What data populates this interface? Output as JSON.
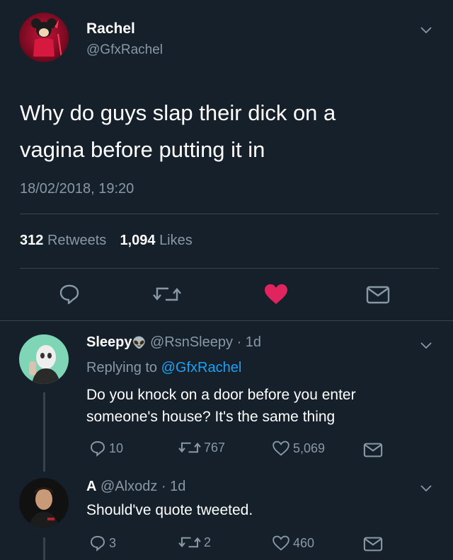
{
  "main_tweet": {
    "author_name": "Rachel",
    "author_handle": "@GfxRachel",
    "text_line1": "Why do guys slap their dick on a",
    "text_line2": "vagina before putting it in",
    "timestamp": "18/02/2018, 19:20",
    "retweets_count": "312",
    "retweets_label": "Retweets",
    "likes_count": "1,094",
    "likes_label": "Likes",
    "liked": true,
    "colors": {
      "like_active": "#e0245e",
      "link": "#1da1f2",
      "background": "#15202b"
    }
  },
  "replies": [
    {
      "author_name": "Sleepy",
      "author_emoji": "👽",
      "author_handle": "@RsnSleepy",
      "time": "· 1d",
      "replying_prefix": "Replying to",
      "replying_handle": "@GfxRachel",
      "text_line1": "Do you knock on a door before you enter",
      "text_line2": "someone's house? It's the same thing",
      "reply_count": "10",
      "retweet_count": "767",
      "like_count": "5,069"
    },
    {
      "author_name": "A",
      "author_handle": "@Alxodz",
      "time": "· 1d",
      "text_line1": "Should've quote tweeted.",
      "reply_count": "3",
      "retweet_count": "2",
      "like_count": "460"
    }
  ]
}
